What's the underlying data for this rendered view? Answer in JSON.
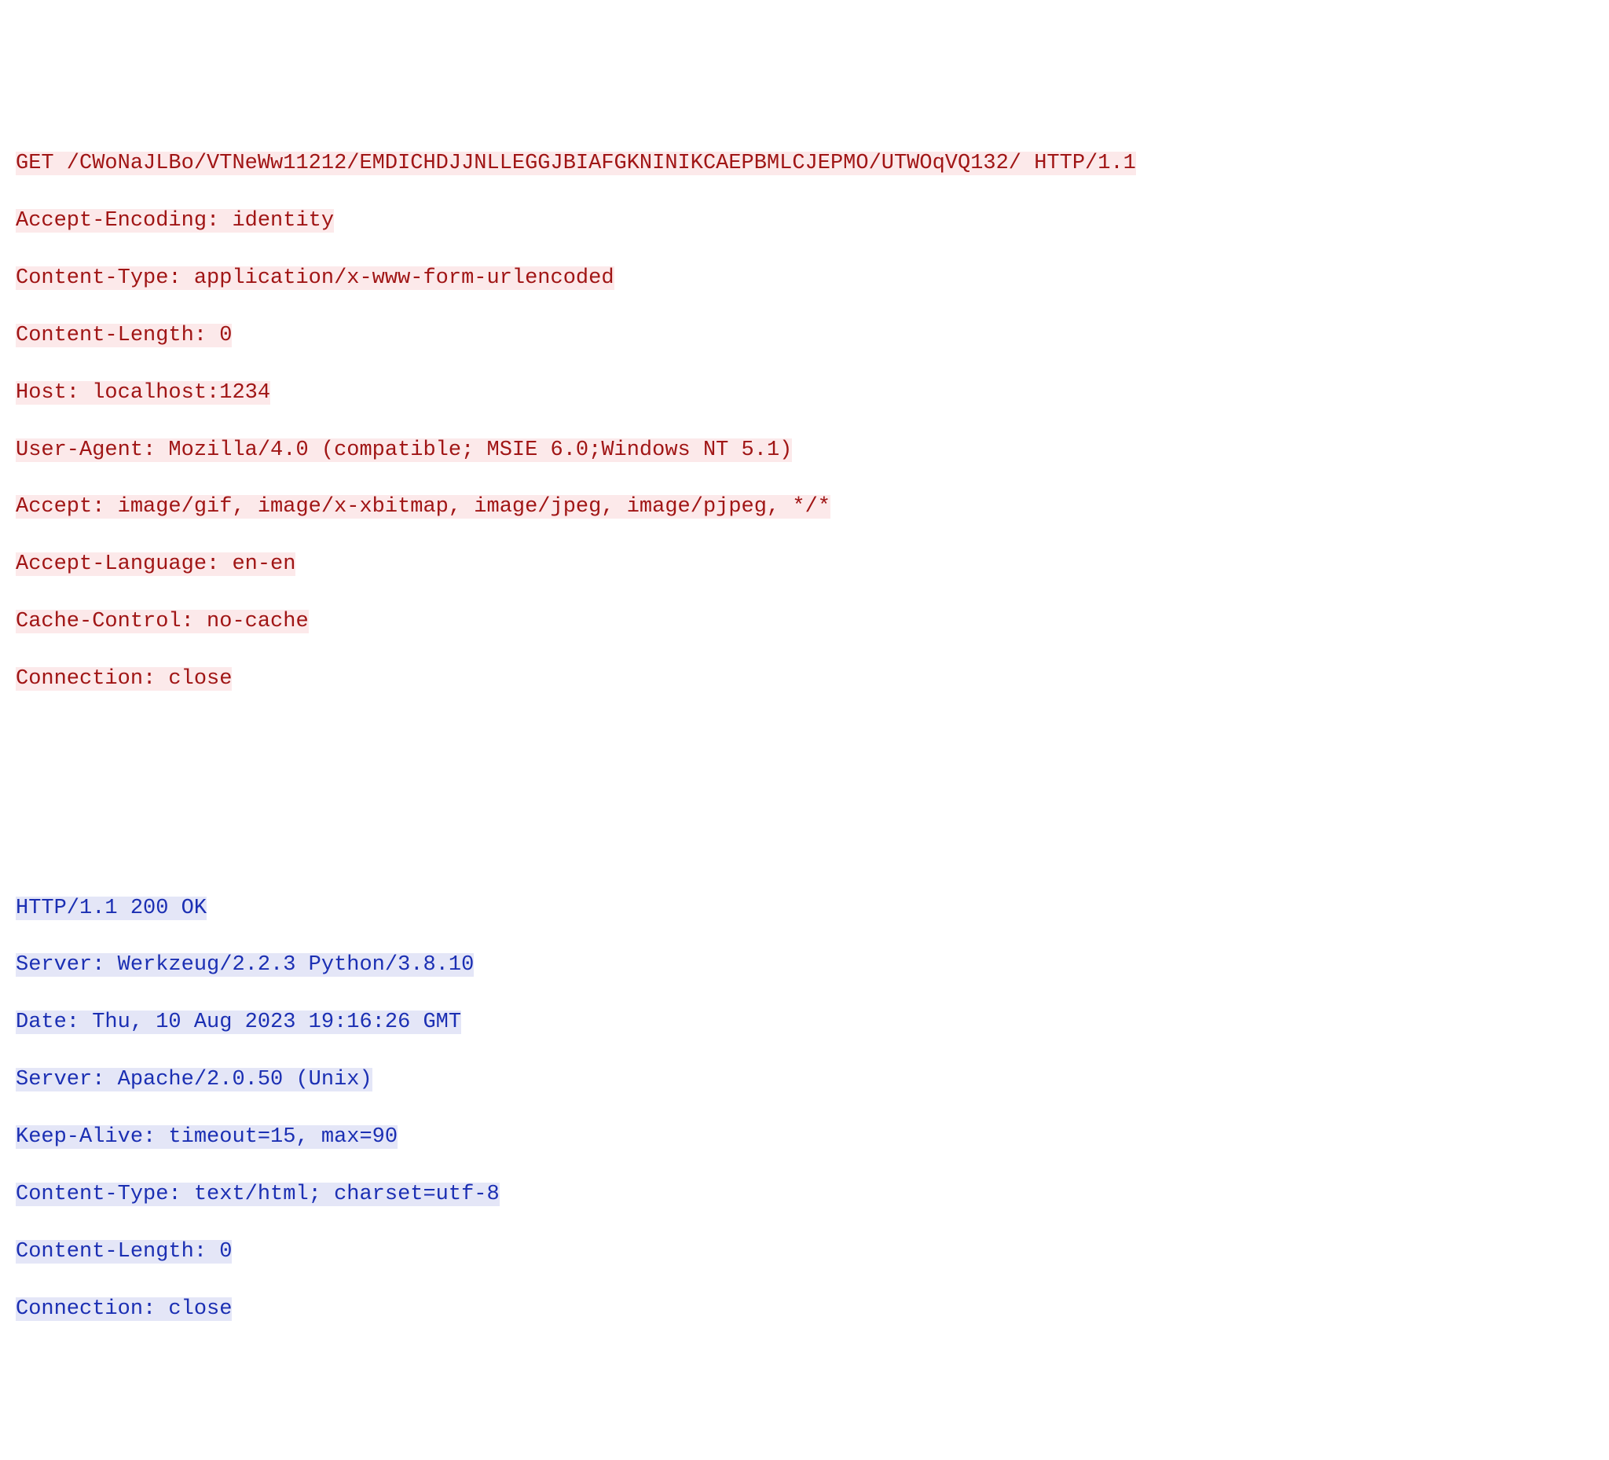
{
  "request": [
    "GET /CWoNaJLBo/VTNeWw11212/EMDICHDJJNLLEGGJBIAFGKNINIKCAEPBMLCJEPMO/UTWOqVQ132/ HTTP/1.1",
    "Accept-Encoding: identity",
    "Content-Type: application/x-www-form-urlencoded",
    "Content-Length: 0",
    "Host: localhost:1234",
    "User-Agent: Mozilla/4.0 (compatible; MSIE 6.0;Windows NT 5.1)",
    "Accept: image/gif, image/x-xbitmap, image/jpeg, image/pjpeg, */*",
    "Accept-Language: en-en",
    "Cache-Control: no-cache",
    "Connection: close"
  ],
  "response": [
    "HTTP/1.1 200 OK",
    "Server: Werkzeug/2.2.3 Python/3.8.10",
    "Date: Thu, 10 Aug 2023 19:16:26 GMT",
    "Server: Apache/2.0.50 (Unix)",
    "Keep-Alive: timeout=15, max=90",
    "Content-Type: text/html; charset=utf-8",
    "Content-Length: 0",
    "Connection: close"
  ]
}
